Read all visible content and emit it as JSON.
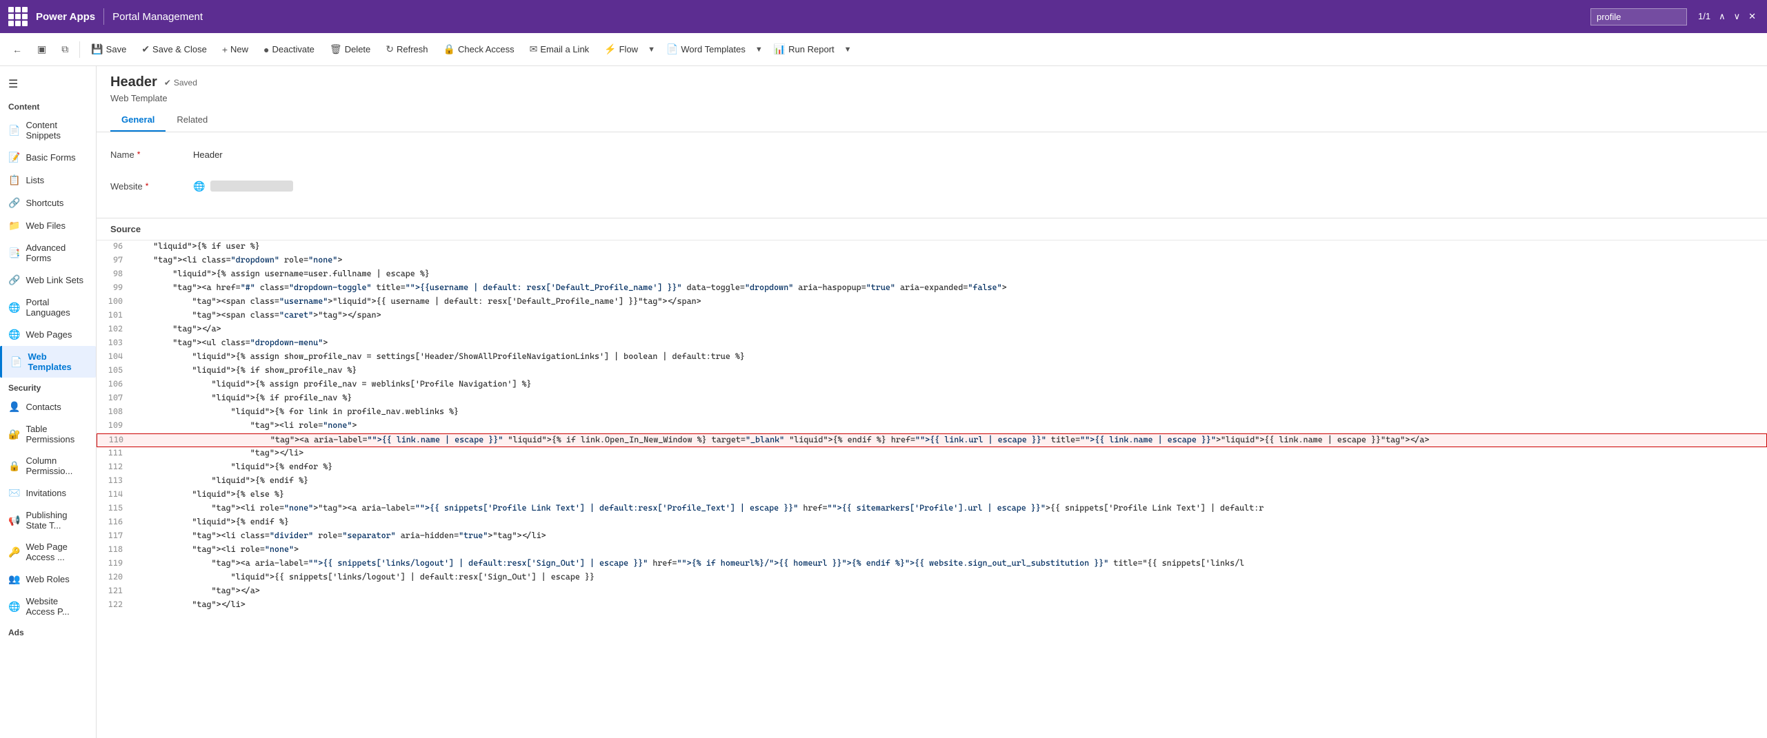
{
  "topbar": {
    "apps_label": "Power Apps",
    "divider": true,
    "app_name": "Portal Management",
    "search_value": "profile",
    "search_page": "1/1"
  },
  "commandbar": {
    "back_label": "←",
    "save_label": "Save",
    "save_close_label": "Save & Close",
    "new_label": "New",
    "deactivate_label": "Deactivate",
    "delete_label": "Delete",
    "refresh_label": "Refresh",
    "check_access_label": "Check Access",
    "email_link_label": "Email a Link",
    "flow_label": "Flow",
    "word_templates_label": "Word Templates",
    "run_report_label": "Run Report"
  },
  "record": {
    "title": "Header",
    "saved_text": "Saved",
    "type": "Web Template",
    "tabs": [
      "General",
      "Related"
    ],
    "active_tab": "General"
  },
  "form": {
    "name_label": "Name",
    "name_required": true,
    "name_value": "Header",
    "website_label": "Website",
    "website_required": true,
    "website_value_width": 120
  },
  "source": {
    "label": "Source",
    "lines": [
      {
        "num": 96,
        "content": "    {% if user %}",
        "highlight": false
      },
      {
        "num": 97,
        "content": "    <li class=\"dropdown\" role=\"none\">",
        "highlight": false
      },
      {
        "num": 98,
        "content": "        {% assign username=user.fullname | escape %}",
        "highlight": false
      },
      {
        "num": 99,
        "content": "        <a href=\"#\" class=\"dropdown-toggle\" title=\"{{username | default: resx['Default_Profile_name'] }}\" data-toggle=\"dropdown\" aria-haspopup=\"true\" aria-expanded=\"false\">",
        "highlight": false
      },
      {
        "num": 100,
        "content": "            <span class=\"username\">{{ username | default: resx['Default_Profile_name'] }}</span>",
        "highlight": false
      },
      {
        "num": 101,
        "content": "            <span class=\"caret\"></span>",
        "highlight": false
      },
      {
        "num": 102,
        "content": "        </a>",
        "highlight": false
      },
      {
        "num": 103,
        "content": "        <ul class=\"dropdown-menu\">",
        "highlight": false
      },
      {
        "num": 104,
        "content": "            {% assign show_profile_nav = settings['Header/ShowAllProfileNavigationLinks'] | boolean | default:true %}",
        "highlight": false
      },
      {
        "num": 105,
        "content": "            {% if show_profile_nav %}",
        "highlight": false
      },
      {
        "num": 106,
        "content": "                {% assign profile_nav = weblinks['Profile Navigation'] %}",
        "highlight": false
      },
      {
        "num": 107,
        "content": "                {% if profile_nav %}",
        "highlight": false
      },
      {
        "num": 108,
        "content": "                    {% for link in profile_nav.weblinks %}",
        "highlight": false
      },
      {
        "num": 109,
        "content": "                        <li role=\"none\">",
        "highlight": false
      },
      {
        "num": 110,
        "content": "                            <a aria-label=\"{{ link.name | escape }}\" {% if link.Open_In_New_Window %} target=\"_blank\" {% endif %} href=\"{{ link.url | escape }}\" title=\"{{ link.name | escape }}\">{{ link.name | escape }}</a>",
        "highlight": true
      },
      {
        "num": 111,
        "content": "                        </li>",
        "highlight": false
      },
      {
        "num": 112,
        "content": "                    {% endfor %}",
        "highlight": false
      },
      {
        "num": 113,
        "content": "                {% endif %}",
        "highlight": false
      },
      {
        "num": 114,
        "content": "            {% else %}",
        "highlight": false
      },
      {
        "num": 115,
        "content": "                <li role=\"none\"><a aria-label=\"{{ snippets['Profile Link Text'] | default:resx['Profile_Text'] | escape }}\" href=\"{{ sitemarkers['Profile'].url | escape }}\">{{ snippets['Profile Link Text'] | default:r",
        "highlight": false
      },
      {
        "num": 116,
        "content": "            {% endif %}",
        "highlight": false
      },
      {
        "num": 117,
        "content": "            <li class=\"divider\" role=\"separator\" aria-hidden=\"true\"></li>",
        "highlight": false
      },
      {
        "num": 118,
        "content": "            <li role=\"none\">",
        "highlight": false
      },
      {
        "num": 119,
        "content": "                <a aria-label=\"{{ snippets['links/logout'] | default:resx['Sign_Out'] | escape }}\" href=\"{% if homeurl%}/{{ homeurl }}{% endif %}{{ website.sign_out_url_substitution }}\" title=\"{{ snippets['links/l",
        "highlight": false
      },
      {
        "num": 120,
        "content": "                    {{ snippets['links/logout'] | default:resx['Sign_Out'] | escape }}",
        "highlight": false
      },
      {
        "num": 121,
        "content": "                </a>",
        "highlight": false
      },
      {
        "num": 122,
        "content": "            </li>",
        "highlight": false
      }
    ]
  },
  "sidebar": {
    "content_section": "Content",
    "security_section": "Security",
    "ads_section": "Ads",
    "items_content": [
      {
        "id": "content-snippets",
        "label": "Content Snippets",
        "icon": "📄"
      },
      {
        "id": "basic-forms",
        "label": "Basic Forms",
        "icon": "📝"
      },
      {
        "id": "lists",
        "label": "Lists",
        "icon": "📋"
      },
      {
        "id": "shortcuts",
        "label": "Shortcuts",
        "icon": "🔗"
      },
      {
        "id": "web-files",
        "label": "Web Files",
        "icon": "📁"
      },
      {
        "id": "advanced-forms",
        "label": "Advanced Forms",
        "icon": "📑"
      },
      {
        "id": "web-link-sets",
        "label": "Web Link Sets",
        "icon": "🔗"
      },
      {
        "id": "portal-languages",
        "label": "Portal Languages",
        "icon": "🌐"
      },
      {
        "id": "web-pages",
        "label": "Web Pages",
        "icon": "🌐"
      },
      {
        "id": "web-templates",
        "label": "Web Templates",
        "icon": "📄",
        "active": true
      }
    ],
    "items_security": [
      {
        "id": "contacts",
        "label": "Contacts",
        "icon": "👤"
      },
      {
        "id": "table-permissions",
        "label": "Table Permissions",
        "icon": "🔐"
      },
      {
        "id": "column-permissions",
        "label": "Column Permissio...",
        "icon": "🔒"
      },
      {
        "id": "invitations",
        "label": "Invitations",
        "icon": "✉️"
      },
      {
        "id": "publishing-state",
        "label": "Publishing State T...",
        "icon": "📢"
      },
      {
        "id": "web-page-access",
        "label": "Web Page Access ...",
        "icon": "🔑"
      },
      {
        "id": "web-roles",
        "label": "Web Roles",
        "icon": "👥"
      },
      {
        "id": "website-access",
        "label": "Website Access P...",
        "icon": "🌐"
      }
    ]
  }
}
